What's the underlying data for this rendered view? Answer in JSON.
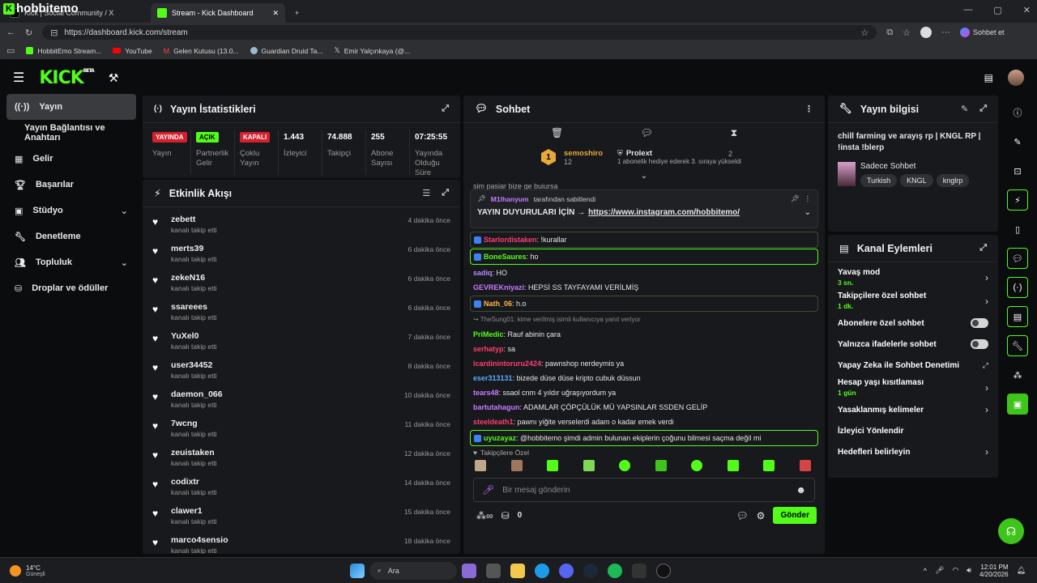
{
  "browser": {
    "overlay_title": "hobbitemo",
    "tabs": [
      {
        "label": "Kick | Social Community / X",
        "active": false
      },
      {
        "label": "Stream - Kick Dashboard",
        "active": true
      }
    ],
    "new_tab": "+",
    "url": "https://dashboard.kick.com/stream",
    "profile_label": "Sohbet et",
    "bookmarks": [
      "HobbitEmo Stream...",
      "YouTube",
      "Gelen Kutusu (13.0...",
      "Guardian Druid Ta...",
      "Emir Yalçınkaya (@..."
    ]
  },
  "kick": {
    "logo": "KICK",
    "logo_beta": "BETA"
  },
  "sidebar": {
    "items": [
      {
        "label": "Yayın",
        "icon": "broadcast-icon"
      },
      {
        "label": "Yayın Bağlantısı ve Anahtarı",
        "icon": ""
      },
      {
        "label": "Gelir",
        "icon": "chart-icon"
      },
      {
        "label": "Başarılar",
        "icon": "trophy-icon"
      },
      {
        "label": "Stüdyo",
        "icon": "studio-icon"
      },
      {
        "label": "Denetleme",
        "icon": "wrench-icon"
      },
      {
        "label": "Topluluk",
        "icon": "community-icon"
      },
      {
        "label": "Droplar ve ödüller",
        "icon": "gift-icon"
      }
    ]
  },
  "stats": {
    "title": "Yayın İstatistikleri",
    "items": [
      {
        "value": "YAYINDA",
        "label": "Yayın",
        "style": "red"
      },
      {
        "value": "AÇIK",
        "label": "Partnerlik Gelir",
        "style": "grn"
      },
      {
        "value": "KAPALI",
        "label": "Çoklu Yayın",
        "style": "red"
      },
      {
        "value": "1.443",
        "label": "İzleyici",
        "style": ""
      },
      {
        "value": "74.888",
        "label": "Takipçi",
        "style": ""
      },
      {
        "value": "255",
        "label": "Abone Sayısı",
        "style": ""
      },
      {
        "value": "07:25:55",
        "label": "Yayında Olduğu Süre",
        "style": ""
      }
    ]
  },
  "activity": {
    "title": "Etkinlik Akışı",
    "sub": "kanalı takip etti",
    "items": [
      {
        "user": "zebett",
        "time": "4 dakika önce"
      },
      {
        "user": "merts39",
        "time": "6 dakika önce"
      },
      {
        "user": "zekeN16",
        "time": "6 dakika önce"
      },
      {
        "user": "ssareees",
        "time": "6 dakika önce"
      },
      {
        "user": "YuXel0",
        "time": "7 dakika önce"
      },
      {
        "user": "user34452",
        "time": "8 dakika önce"
      },
      {
        "user": "daemon_066",
        "time": "10 dakika önce"
      },
      {
        "user": "7wcng",
        "time": "11 dakika önce"
      },
      {
        "user": "zeuistaken",
        "time": "12 dakika önce"
      },
      {
        "user": "codixtr",
        "time": "14 dakika önce"
      },
      {
        "user": "clawer1",
        "time": "15 dakika önce"
      },
      {
        "user": "marco4sensio",
        "time": "18 dakika önce"
      }
    ]
  },
  "chat": {
    "title": "Sohbet",
    "top_gifter_1": {
      "rank": "1",
      "name": "semoshiro",
      "count": "12"
    },
    "top_gifter_2": {
      "name": "Prolext",
      "count": "2",
      "note": "1 abonelik hediye ederek 3. sıraya yükseldi"
    },
    "pinned_by": "M1lhanyum",
    "pinned_by_suffix": "tarafından sabitlendi",
    "pinned_text": "YAYIN DUYURULARI İÇİN →",
    "pinned_link": "https://www.instagram.com/hobbitemo/",
    "cut_msg": "sim pasiar bize ge buiursa",
    "messages": [
      {
        "user": "Starlordistaken",
        "color": "#ff3d6e",
        "text": ": !kurallar",
        "style": "box2"
      },
      {
        "user": "BoneSaures",
        "color": "#53fc18",
        "text": ": ho",
        "style": "box"
      },
      {
        "user": "sadiq",
        "color": "#b18cff",
        "text": ": HO",
        "style": ""
      },
      {
        "user": "GEVREKniyazi",
        "color": "#c57cff",
        "text": ": HEPSİ SS TAYFAYAMI VERİLMİŞ",
        "style": ""
      },
      {
        "user": "Nath_06",
        "color": "#ffb347",
        "text": ": h.o",
        "style": "box2"
      },
      {
        "user": "PriMedic",
        "color": "#53fc18",
        "text": ": Rauf abinin çara",
        "style": ""
      },
      {
        "user": "serhatyp",
        "color": "#ff3d6e",
        "text": ": sa",
        "style": ""
      },
      {
        "user": "icardinintoruru2424",
        "color": "#ff3d6e",
        "text": ": pawnshop nerdeymis ya",
        "style": ""
      },
      {
        "user": "eser313131",
        "color": "#5aa9ff",
        "text": ": bizede düse düse kripto cubuk düssun",
        "style": ""
      },
      {
        "user": "tears48",
        "color": "#c57cff",
        "text": ": ssaol cnm 4 yıldır uğraşıyordum ya",
        "style": ""
      },
      {
        "user": "bartutahagun",
        "color": "#c57cff",
        "text": ": ADAMLAR ÇÖPÇÜLÜK MÜ YAPSINLAR SSDEN GELİP",
        "style": ""
      },
      {
        "user": "steeldeath1",
        "color": "#ff3d6e",
        "text": ": pawnı yiğite verselerdi adam o kadar emek verdi",
        "style": ""
      },
      {
        "user": "uyuzayaz",
        "color": "#53fc18",
        "text": ": @hobbitemo şimdi admin bulunan ekiplerin çoğunu bilmesi saçma değil mi",
        "style": "box"
      }
    ],
    "reply_note": "TheSung01: kime verilmiş isimli kullanıcıya yanıt veriyor",
    "followers_only": "Takipçilere Özel",
    "input_placeholder": "Bir mesaj gönderin",
    "points": "0",
    "send": "Gönder"
  },
  "info": {
    "title": "Yayın bilgisi",
    "stream_title": "chill farming ve arayış rp | KNGL RP | !insta !blerp",
    "category": "Sadece Sohbet",
    "tags": [
      "Turkish",
      "KNGL",
      "knglrp"
    ]
  },
  "channel": {
    "title": "Kanal Eylemleri",
    "items": [
      {
        "label": "Yavaş mod",
        "sub": "3 sn.",
        "ctrl": "chev"
      },
      {
        "label": "Takipçilere özel sohbet",
        "sub": "1 dk.",
        "ctrl": "chev"
      },
      {
        "label": "Abonelere özel sohbet",
        "sub": "",
        "ctrl": "toggle"
      },
      {
        "label": "Yalnızca ifadelerle sohbet",
        "sub": "",
        "ctrl": "toggle"
      },
      {
        "label": "Yapay Zeka ile Sohbet Denetimi",
        "sub": "",
        "ctrl": "ext"
      },
      {
        "label": "Hesap yaşı kısıtlaması",
        "sub": "1 gün",
        "ctrl": "chev"
      },
      {
        "label": "Yasaklanmış kelimeler",
        "sub": "",
        "ctrl": "chev"
      },
      {
        "label": "İzleyici Yönlendir",
        "sub": "",
        "ctrl": ""
      },
      {
        "label": "Hedefleri belirleyin",
        "sub": "",
        "ctrl": "chev"
      }
    ]
  },
  "taskbar": {
    "weather_temp": "14°C",
    "weather_desc": "Güneşli",
    "search": "Ara",
    "time": "12:01 PM",
    "date": "4/20/2026"
  },
  "colors": {
    "accent": "#53fc18",
    "live": "#d3202c"
  }
}
